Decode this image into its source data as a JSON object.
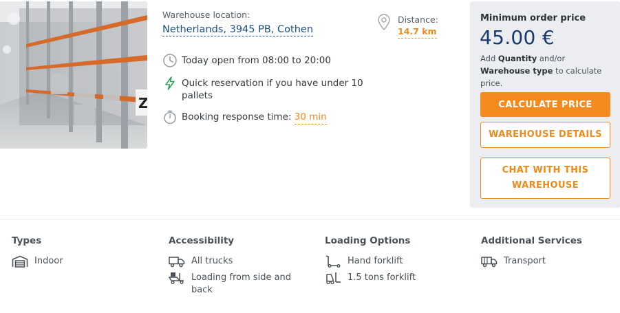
{
  "listing": {
    "location_label": "Warehouse location:",
    "location_value": "Netherlands, 3945 PB, Cothen",
    "open_hours": "Today open from 08:00 to 20:00",
    "quick_reservation": "Quick reservation if you have under 10 pallets",
    "response_label": "Booking response time:",
    "response_value": "30 min",
    "distance_label": "Distance:",
    "distance_value": "14.7 km",
    "photo_label": "Z"
  },
  "pricing": {
    "min_label": "Minimum order price",
    "amount": "45.00 €",
    "note_prefix": "Add",
    "note_quantity": "Quantity",
    "note_and": "and/or",
    "note_type": "Warehouse type",
    "note_suffix": "to calculate price.",
    "calculate_label": "CALCULATE PRICE",
    "details_label": "WAREHOUSE DETAILS",
    "chat_label": "CHAT WITH THIS WAREHOUSE"
  },
  "attributes": {
    "types": {
      "title": "Types",
      "items": [
        {
          "label": "Indoor",
          "icon": "warehouse-icon"
        }
      ]
    },
    "accessibility": {
      "title": "Accessibility",
      "items": [
        {
          "label": "All trucks",
          "icon": "truck-icon"
        },
        {
          "label": "Loading from side and back",
          "icon": "loading-icon"
        }
      ]
    },
    "loading": {
      "title": "Loading Options",
      "items": [
        {
          "label": "Hand forklift",
          "icon": "hand-forklift-icon"
        },
        {
          "label": "1.5 tons forklift",
          "icon": "forklift-icon"
        }
      ]
    },
    "services": {
      "title": "Additional Services",
      "items": [
        {
          "label": "Transport",
          "icon": "transport-truck-icon"
        }
      ]
    }
  },
  "colors": {
    "accent": "#f58a1f",
    "primary": "#173c6b",
    "panel": "#ebedf0"
  }
}
